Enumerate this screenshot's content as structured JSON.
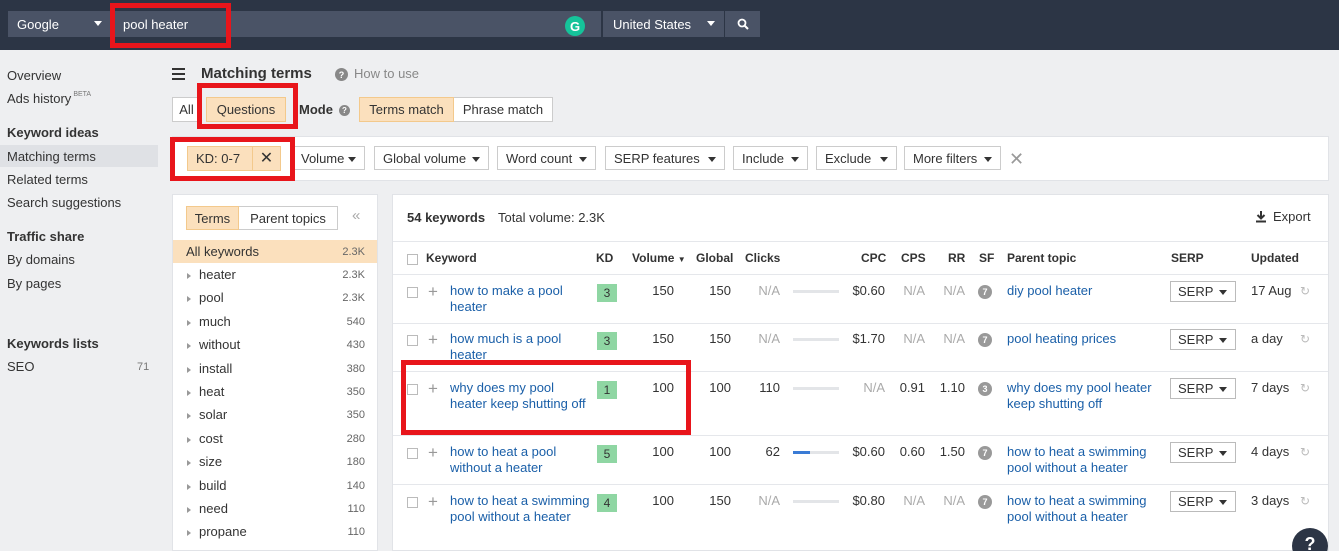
{
  "search": {
    "engine": "Google",
    "query": "pool heater",
    "country": "United States",
    "grammarly_letter": "G"
  },
  "leftnav": {
    "overview": "Overview",
    "ads_history": "Ads history",
    "ads_history_badge": "BETA",
    "keyword_ideas_heading": "Keyword ideas",
    "matching_terms": "Matching terms",
    "related_terms": "Related terms",
    "search_suggestions": "Search suggestions",
    "traffic_share_heading": "Traffic share",
    "by_domains": "By domains",
    "by_pages": "By pages",
    "keywords_lists_heading": "Keywords lists",
    "seo_list": "SEO",
    "seo_count": "71"
  },
  "header": {
    "title": "Matching terms",
    "how_to_use": "How to use"
  },
  "tabs": {
    "all": "All",
    "questions": "Questions",
    "mode_label": "Mode",
    "terms_match": "Terms match",
    "phrase_match": "Phrase match"
  },
  "filters": {
    "kd_chip": "KD: 0-7",
    "kd_clear": "✕",
    "volume": "Volume",
    "global_volume": "Global volume",
    "word_count": "Word count",
    "serp_features": "SERP features",
    "include": "Include",
    "exclude": "Exclude",
    "more_filters": "More filters",
    "clear_all": "✕"
  },
  "leftpanel": {
    "terms_tab": "Terms",
    "parent_topics_tab": "Parent topics",
    "collapse": "«",
    "all_keywords": {
      "label": "All keywords",
      "count": "2.3K"
    },
    "rows": [
      {
        "label": "heater",
        "count": "2.3K"
      },
      {
        "label": "pool",
        "count": "2.3K"
      },
      {
        "label": "much",
        "count": "540"
      },
      {
        "label": "without",
        "count": "430"
      },
      {
        "label": "install",
        "count": "380"
      },
      {
        "label": "heat",
        "count": "350"
      },
      {
        "label": "solar",
        "count": "350"
      },
      {
        "label": "cost",
        "count": "280"
      },
      {
        "label": "size",
        "count": "180"
      },
      {
        "label": "build",
        "count": "140"
      },
      {
        "label": "need",
        "count": "110"
      },
      {
        "label": "propane",
        "count": "110"
      }
    ]
  },
  "table": {
    "keyword_count": "54 keywords",
    "total_volume": "Total volume: 2.3K",
    "export": "Export",
    "headers": {
      "keyword": "Keyword",
      "kd": "KD",
      "volume": "Volume",
      "global": "Global",
      "clicks": "Clicks",
      "cpc": "CPC",
      "cps": "CPS",
      "rr": "RR",
      "sf": "SF",
      "parent_topic": "Parent topic",
      "serp": "SERP",
      "updated": "Updated"
    },
    "rows": [
      {
        "keyword": "how to make a pool heater",
        "kd": "3",
        "kd_color": "#8fd6a3",
        "volume": "150",
        "global": "150",
        "clicks": "N/A",
        "clicks_fill": 0,
        "cpc": "$0.60",
        "cps": "N/A",
        "rr": "N/A",
        "sf": "7",
        "parent_topic": "diy pool heater",
        "serp": "SERP",
        "updated": "17 Aug"
      },
      {
        "keyword": "how much is a pool heater",
        "kd": "3",
        "kd_color": "#8fd6a3",
        "volume": "150",
        "global": "150",
        "clicks": "N/A",
        "clicks_fill": 0,
        "cpc": "$1.70",
        "cps": "N/A",
        "rr": "N/A",
        "sf": "7",
        "parent_topic": "pool heating prices",
        "serp": "SERP",
        "updated": "a day"
      },
      {
        "keyword": "why does my pool heater keep shutting off",
        "kd": "1",
        "kd_color": "#8fd6a3",
        "volume": "100",
        "global": "100",
        "clicks": "110",
        "clicks_fill": 0,
        "cpc": "N/A",
        "cps": "0.91",
        "rr": "1.10",
        "sf": "3",
        "parent_topic": "why does my pool heater keep shutting off",
        "serp": "SERP",
        "updated": "7 days"
      },
      {
        "keyword": "how to heat a pool without a heater",
        "kd": "5",
        "kd_color": "#8fd6a3",
        "volume": "100",
        "global": "100",
        "clicks": "62",
        "clicks_fill": 0.38,
        "cpc": "$0.60",
        "cps": "0.60",
        "rr": "1.50",
        "sf": "7",
        "parent_topic": "how to heat a swimming pool without a heater",
        "serp": "SERP",
        "updated": "4 days"
      },
      {
        "keyword": "how to heat a swimming pool without a heater",
        "kd": "4",
        "kd_color": "#8fd6a3",
        "volume": "100",
        "global": "150",
        "clicks": "N/A",
        "clicks_fill": 0,
        "cpc": "$0.80",
        "cps": "N/A",
        "rr": "N/A",
        "sf": "7",
        "parent_topic": "how to heat a swimming pool without a heater",
        "serp": "SERP",
        "updated": "3 days"
      }
    ]
  },
  "help_bubble": "?",
  "colors": {
    "topbar": "#2c3545",
    "accent_orange": "#fbe0bd",
    "link_blue": "#1a5fa8",
    "highlight_red": "#e8151b",
    "kd_green": "#8fd6a3"
  }
}
